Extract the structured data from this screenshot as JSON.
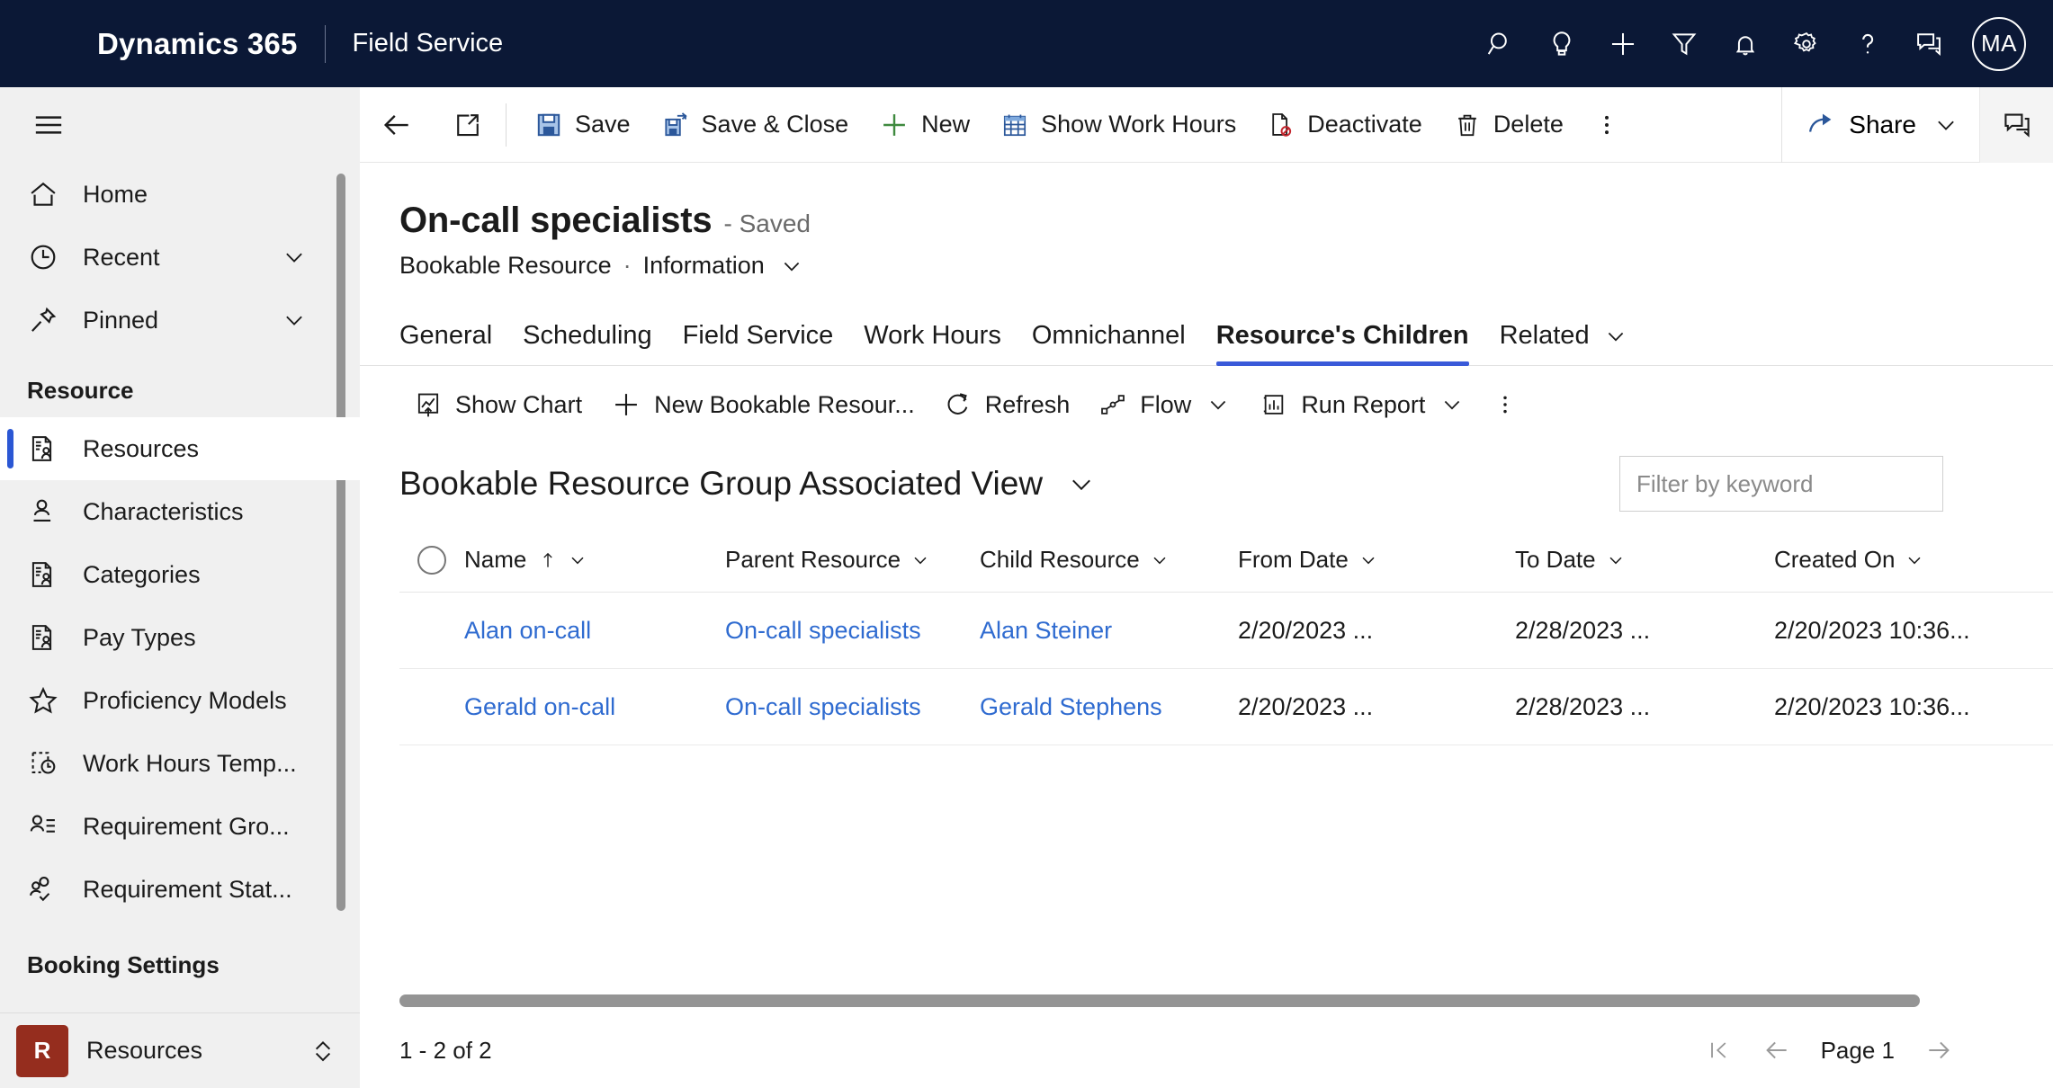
{
  "topnav": {
    "brand": "Dynamics 365",
    "app_name": "Field Service",
    "icons": [
      {
        "name": "search-icon",
        "label": "Search"
      },
      {
        "name": "lightbulb-icon",
        "label": "Ideas"
      },
      {
        "name": "plus-icon",
        "label": "Quick create"
      },
      {
        "name": "filter-icon",
        "label": "Filter"
      },
      {
        "name": "bell-icon",
        "label": "Notifications"
      },
      {
        "name": "gear-icon",
        "label": "Settings"
      },
      {
        "name": "question-icon",
        "label": "Help"
      },
      {
        "name": "feedback-icon",
        "label": "Feedback"
      }
    ],
    "avatar_initials": "MA",
    "bg_color": "#0b1836"
  },
  "sidebar": {
    "hamburger_label": "Site map",
    "items": [
      {
        "label": "Home",
        "icon": "home-icon",
        "chevron": false,
        "active": false
      },
      {
        "label": "Recent",
        "icon": "clock-icon",
        "chevron": true,
        "active": false
      },
      {
        "label": "Pinned",
        "icon": "pin-icon",
        "chevron": true,
        "active": false
      }
    ],
    "group_resource": "Resource",
    "resource_items": [
      {
        "label": "Resources",
        "icon": "resource-icon",
        "active": true
      },
      {
        "label": "Characteristics",
        "icon": "person-badge-icon",
        "active": false
      },
      {
        "label": "Categories",
        "icon": "resource-icon",
        "active": false
      },
      {
        "label": "Pay Types",
        "icon": "resource-icon",
        "active": false
      },
      {
        "label": "Proficiency Models",
        "icon": "star-icon",
        "active": false
      },
      {
        "label": "Work Hours Temp...",
        "icon": "work-hours-icon",
        "active": false
      },
      {
        "label": "Requirement Gro...",
        "icon": "person-list-icon",
        "active": false
      },
      {
        "label": "Requirement Stat...",
        "icon": "person-check-icon",
        "active": false
      }
    ],
    "group_booking": "Booking Settings",
    "area_switcher": {
      "tile": "R",
      "label": "Resources",
      "tile_color": "#952d1e"
    },
    "active_indicator_color": "#2b57d4"
  },
  "command_bar": {
    "back_label": "Back",
    "popout_label": "Open in new window",
    "buttons": [
      {
        "label": "Save",
        "icon": "save-icon"
      },
      {
        "label": "Save & Close",
        "icon": "save-close-icon"
      },
      {
        "label": "New",
        "icon": "plus-icon"
      },
      {
        "label": "Show Work Hours",
        "icon": "calendar-icon"
      },
      {
        "label": "Deactivate",
        "icon": "deactivate-icon"
      },
      {
        "label": "Delete",
        "icon": "trash-icon"
      }
    ],
    "overflow_label": "More commands",
    "share_label": "Share",
    "assist_label": "Copilot"
  },
  "record": {
    "title": "On-call specialists",
    "saved_status": "- Saved",
    "entity": "Bookable Resource",
    "separator": "·",
    "form_name": "Information"
  },
  "tabs": [
    {
      "label": "General",
      "selected": false,
      "chevron": false
    },
    {
      "label": "Scheduling",
      "selected": false,
      "chevron": false
    },
    {
      "label": "Field Service",
      "selected": false,
      "chevron": false
    },
    {
      "label": "Work Hours",
      "selected": false,
      "chevron": false
    },
    {
      "label": "Omnichannel",
      "selected": false,
      "chevron": false
    },
    {
      "label": "Resource's Children",
      "selected": true,
      "chevron": false
    },
    {
      "label": "Related",
      "selected": false,
      "chevron": true
    }
  ],
  "tab_accent_color": "#3a5ad9",
  "subgrid": {
    "commands": [
      {
        "label": "Show Chart",
        "icon": "show-chart-icon",
        "chevron": false
      },
      {
        "label": "New Bookable Resour...",
        "icon": "plus-icon",
        "chevron": false
      },
      {
        "label": "Refresh",
        "icon": "refresh-icon",
        "chevron": false
      },
      {
        "label": "Flow",
        "icon": "flow-icon",
        "chevron": true
      },
      {
        "label": "Run Report",
        "icon": "report-icon",
        "chevron": true
      }
    ],
    "overflow_label": "More commands",
    "view_name": "Bookable Resource Group Associated View",
    "filter_placeholder": "Filter by keyword",
    "filter_value": "",
    "columns": [
      {
        "label": "Name",
        "sort": "asc"
      },
      {
        "label": "Parent Resource",
        "sort": null
      },
      {
        "label": "Child Resource",
        "sort": null
      },
      {
        "label": "From Date",
        "sort": null
      },
      {
        "label": "To Date",
        "sort": null
      },
      {
        "label": "Created On",
        "sort": null
      }
    ],
    "rows": [
      {
        "name": "Alan on-call",
        "parent_resource": "On-call specialists",
        "child_resource": "Alan Steiner",
        "from_date": "2/20/2023 ...",
        "to_date": "2/28/2023 ...",
        "created_on": "2/20/2023 10:36..."
      },
      {
        "name": "Gerald on-call",
        "parent_resource": "On-call specialists",
        "child_resource": "Gerald Stephens",
        "from_date": "2/20/2023 ...",
        "to_date": "2/28/2023 ...",
        "created_on": "2/20/2023 10:36..."
      }
    ],
    "link_color": "#2f6bd0"
  },
  "footer": {
    "record_count": "1 - 2 of 2",
    "page_label": "Page 1",
    "first_page_label": "First page",
    "prev_page_label": "Previous page",
    "next_page_label": "Next page"
  }
}
